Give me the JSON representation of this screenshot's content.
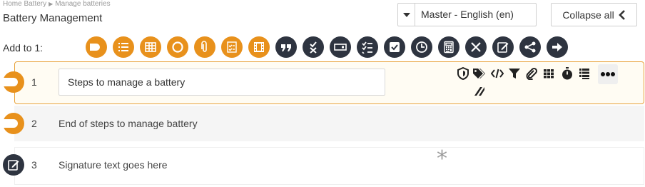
{
  "breadcrumb": {
    "home": "Home Battery",
    "separator": "▶",
    "current": "Manage batteries"
  },
  "page_title": "Battery Management",
  "language_select": {
    "value": "Master - English (en)"
  },
  "collapse_button": {
    "label": "Collapse all"
  },
  "toolbar": {
    "add_label": "Add to 1:",
    "tools": [
      {
        "icon": "step-icon",
        "color": "#e8911c"
      },
      {
        "icon": "list-icon",
        "color": "#e8911c"
      },
      {
        "icon": "table-icon",
        "color": "#e8911c"
      },
      {
        "icon": "circle-icon",
        "color": "#e8911c"
      },
      {
        "icon": "attachment-icon",
        "color": "#e8911c"
      },
      {
        "icon": "checklist-icon",
        "color": "#e8911c"
      },
      {
        "icon": "film-icon",
        "color": "#e8911c"
      },
      {
        "icon": "quote-icon",
        "color": "#2e3440"
      },
      {
        "icon": "check-cross-icon",
        "color": "#2e3440"
      },
      {
        "icon": "input-field-icon",
        "color": "#2e3440"
      },
      {
        "icon": "checklist-icon",
        "color": "#2e3440"
      },
      {
        "icon": "checkbox-icon",
        "color": "#2e3440"
      },
      {
        "icon": "clock-icon",
        "color": "#2e3440"
      },
      {
        "icon": "calculator-icon",
        "color": "#2e3440"
      },
      {
        "icon": "tools-icon",
        "color": "#2e3440"
      },
      {
        "icon": "signature-icon",
        "color": "#2e3440"
      },
      {
        "icon": "share-icon",
        "color": "#2e3440"
      },
      {
        "icon": "arrow-right-icon",
        "color": "#2e3440"
      }
    ]
  },
  "rows": [
    {
      "number": "1",
      "text": "Steps to manage a battery",
      "badge_color": "#e8911c"
    },
    {
      "number": "2",
      "text": "End of steps to manage battery",
      "badge_color": "#e8911c"
    },
    {
      "number": "3",
      "text": "Signature text goes here",
      "badge_color": "#2e3440"
    }
  ],
  "row_actions": [
    "shield-icon",
    "tags-icon",
    "code-icon",
    "filter-icon",
    "paperclip-icon",
    "grid-icon",
    "stopwatch-icon",
    "layers-icon",
    "more-icon",
    "slash-icon"
  ],
  "required_marker": "*",
  "colors": {
    "accent": "#e8911c",
    "dark": "#2e3440",
    "highlight_border": "#e8a23a"
  }
}
